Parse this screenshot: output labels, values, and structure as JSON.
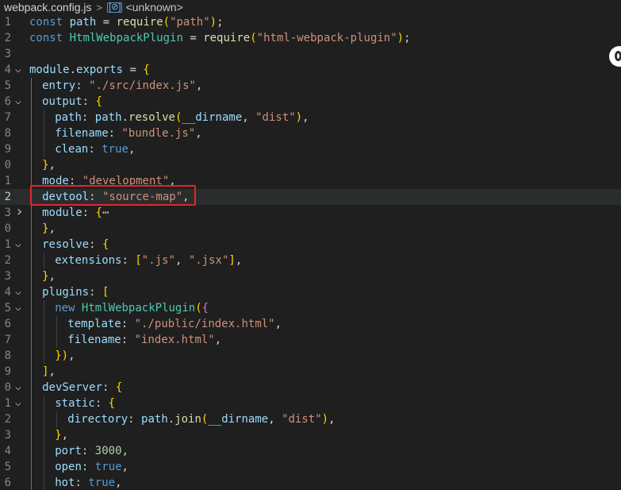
{
  "breadcrumb": {
    "file": "webpack.config.js",
    "separator": ">",
    "symbol_icon": "[⊘]",
    "symbol": "<unknown>"
  },
  "editor": {
    "current_line": 12,
    "lines": [
      {
        "n": "1",
        "t": "const path = require(\"path\");"
      },
      {
        "n": "2",
        "t": "const HtmlWebpackPlugin = require(\"html-webpack-plugin\");"
      },
      {
        "n": "3",
        "t": ""
      },
      {
        "n": "4",
        "t": "module.exports = {"
      },
      {
        "n": "5",
        "t": "entry: \"./src/index.js\","
      },
      {
        "n": "6",
        "t": "output: {"
      },
      {
        "n": "7",
        "t": "path: path.resolve(__dirname, \"dist\"),"
      },
      {
        "n": "8",
        "t": "filename: \"bundle.js\","
      },
      {
        "n": "9",
        "t": "clean: true,"
      },
      {
        "n": "0",
        "t": "},"
      },
      {
        "n": "1",
        "t": "mode: \"development\","
      },
      {
        "n": "2",
        "t": "devtool: \"source-map\","
      },
      {
        "n": "3",
        "t": "module: {⋯"
      },
      {
        "n": "0",
        "t": "},"
      },
      {
        "n": "1",
        "t": "resolve: {"
      },
      {
        "n": "2",
        "t": "extensions: [\".js\", \".jsx\"],"
      },
      {
        "n": "3",
        "t": "},"
      },
      {
        "n": "4",
        "t": "plugins: ["
      },
      {
        "n": "5",
        "t": "new HtmlWebpackPlugin({"
      },
      {
        "n": "6",
        "t": "template: \"./public/index.html\","
      },
      {
        "n": "7",
        "t": "filename: \"index.html\","
      },
      {
        "n": "8",
        "t": "}),"
      },
      {
        "n": "9",
        "t": "],"
      },
      {
        "n": "0",
        "t": "devServer: {"
      },
      {
        "n": "1",
        "t": "static: {"
      },
      {
        "n": "2",
        "t": "directory: path.join(__dirname, \"dist\"),"
      },
      {
        "n": "3",
        "t": "},"
      },
      {
        "n": "4",
        "t": "port: 3000,"
      },
      {
        "n": "5",
        "t": "open: true,"
      },
      {
        "n": "6",
        "t": "hot: true,"
      }
    ]
  },
  "colors": {
    "background": "#1f1f1f",
    "keyword": "#569cd6",
    "function": "#dcdcaa",
    "string": "#ce9178",
    "property": "#9cdcfe",
    "class": "#4ec9b0",
    "number": "#b5cea8",
    "highlight_box": "#e0262d"
  },
  "icons": {
    "fold_expanded": "chevron-down-icon",
    "fold_collapsed": "chevron-right-icon",
    "avatar": "avatar-icon"
  }
}
